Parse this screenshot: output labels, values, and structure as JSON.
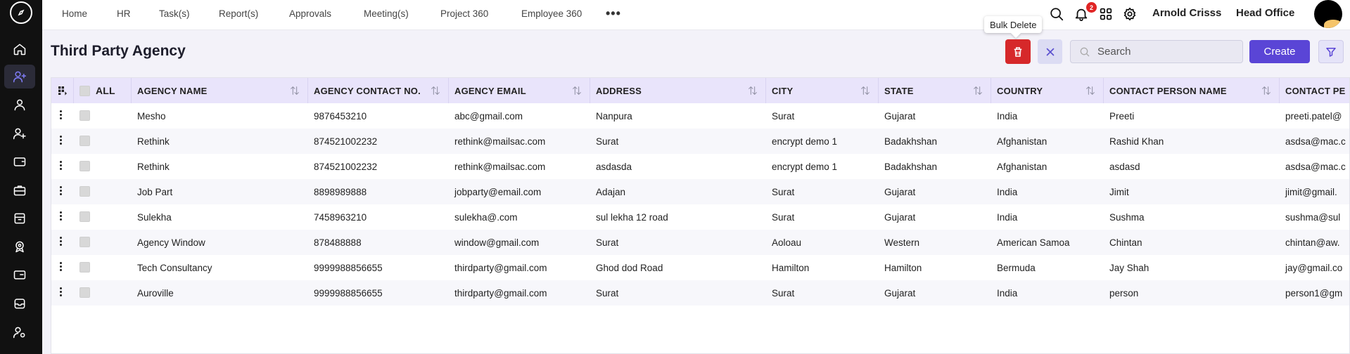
{
  "nav": {
    "items": [
      "Home",
      "HR",
      "Task(s)",
      "Report(s)",
      "Approvals",
      "Meeting(s)",
      "Project 360",
      "Employee 360"
    ],
    "more_label": "•••",
    "notification_count": "2",
    "user_name": "Arnold Crisss",
    "branch_name": "Head Office"
  },
  "page": {
    "title": "Third Party Agency",
    "tooltip": "Bulk Delete",
    "search_placeholder": "Search",
    "create_label": "Create"
  },
  "table": {
    "select_all_label": "ALL",
    "columns": [
      "AGENCY NAME",
      "AGENCY CONTACT NO.",
      "AGENCY EMAIL",
      "ADDRESS",
      "CITY",
      "STATE",
      "COUNTRY",
      "CONTACT PERSON NAME",
      "CONTACT PE"
    ],
    "rows": [
      [
        "Mesho",
        "9876453210",
        "abc@gmail.com",
        "Nanpura",
        "Surat",
        "Gujarat",
        "India",
        "Preeti",
        "preeti.patel@"
      ],
      [
        "Rethink",
        "874521002232",
        "rethink@mailsac.com",
        "Surat",
        "encrypt demo 1",
        "Badakhshan",
        "Afghanistan",
        "Rashid Khan",
        "asdsa@mac.c"
      ],
      [
        "Rethink",
        "874521002232",
        "rethink@mailsac.com",
        "asdasda",
        "encrypt demo 1",
        "Badakhshan",
        "Afghanistan",
        "asdasd",
        "asdsa@mac.c"
      ],
      [
        "Job Part",
        "8898989888",
        "jobparty@email.com",
        "Adajan",
        "Surat",
        "Gujarat",
        "India",
        "Jimit",
        "jimit@gmail."
      ],
      [
        "Sulekha",
        "7458963210",
        "sulekha@.com",
        "sul lekha 12 road",
        "Surat",
        "Gujarat",
        "India",
        "Sushma",
        "sushma@sul"
      ],
      [
        "Agency Window",
        "878488888",
        "window@gmail.com",
        "Surat",
        "Aoloau",
        "Western",
        "American Samoa",
        "Chintan",
        "chintan@aw."
      ],
      [
        "Tech Consultancy",
        "9999988856655",
        "thirdparty@gmail.com",
        "Ghod dod Road",
        "Hamilton",
        "Hamilton",
        "Bermuda",
        "Jay Shah",
        "jay@gmail.co"
      ],
      [
        "Auroville",
        "9999988856655",
        "thirdparty@gmail.com",
        "Surat",
        "Surat",
        "Gujarat",
        "India",
        "person",
        "person1@gm"
      ]
    ]
  },
  "colors": {
    "accent": "#5a45d6",
    "danger": "#d6282a",
    "sidebar": "#111111",
    "header_row": "#e9e4fb"
  },
  "icons": {
    "sidebar": [
      "home-icon",
      "user-plus-icon",
      "user-icon",
      "users-plus-icon",
      "wallet-icon",
      "briefcase-icon",
      "archive-icon",
      "award-icon",
      "card-icon",
      "inbox-icon",
      "user-settings-icon"
    ],
    "topbar": [
      "search-icon",
      "bell-icon",
      "apps-grid-icon",
      "gear-icon"
    ]
  }
}
